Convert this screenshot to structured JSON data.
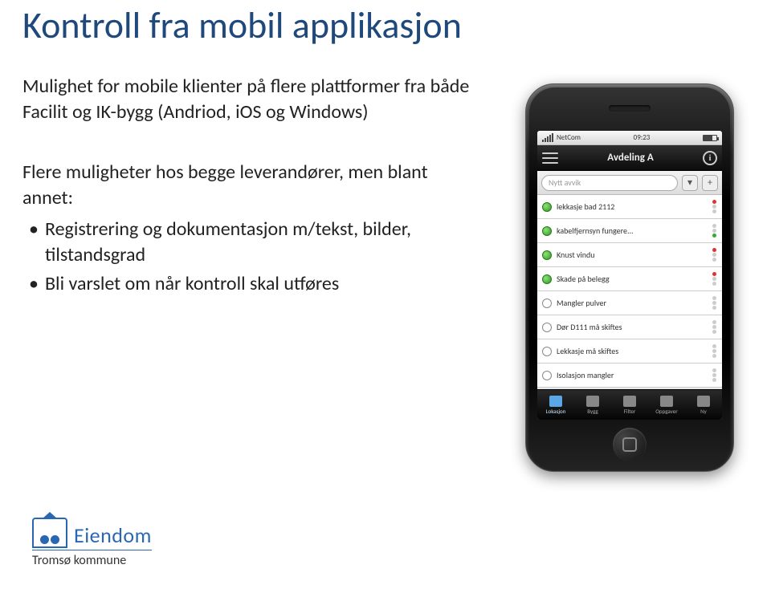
{
  "title": "Kontroll fra mobil applikasjon",
  "intro": "Mulighet for mobile klienter på flere plattformer fra både Facilit og IK-bygg (Andriod, iOS og Windows)",
  "sub_heading": "Flere muligheter hos begge leverandører, men blant annet:",
  "bullets": [
    "Registrering og dokumentasjon m/tekst, bilder, tilstandsgrad",
    "Bli varslet om når kontroll skal utføres"
  ],
  "phone": {
    "carrier": "NetCom",
    "time": "09:23",
    "app_title": "Avdeling A",
    "search_placeholder": "Nytt avvik",
    "rows": [
      {
        "status": "green",
        "text": "lekkasje bad 2112",
        "light": "r"
      },
      {
        "status": "green",
        "text": "kabelfjernsyn fungere...",
        "light": "g"
      },
      {
        "status": "green",
        "text": "Knust vindu",
        "light": "r"
      },
      {
        "status": "green",
        "text": "Skade på belegg",
        "light": "r"
      },
      {
        "status": "empty",
        "text": "Mangler pulver",
        "light": "off"
      },
      {
        "status": "empty",
        "text": "Dør D111 må skiftes",
        "light": "off"
      },
      {
        "status": "empty",
        "text": "Lekkasje må skiftes",
        "light": "off"
      },
      {
        "status": "empty",
        "text": "Isolasjon mangler",
        "light": "off"
      }
    ],
    "tabs": [
      "Lokasjon",
      "Bygg",
      "Filter",
      "Oppgaver",
      "Ny"
    ]
  },
  "logo": {
    "brand": "Eiendom",
    "org": "Tromsø kommune"
  }
}
